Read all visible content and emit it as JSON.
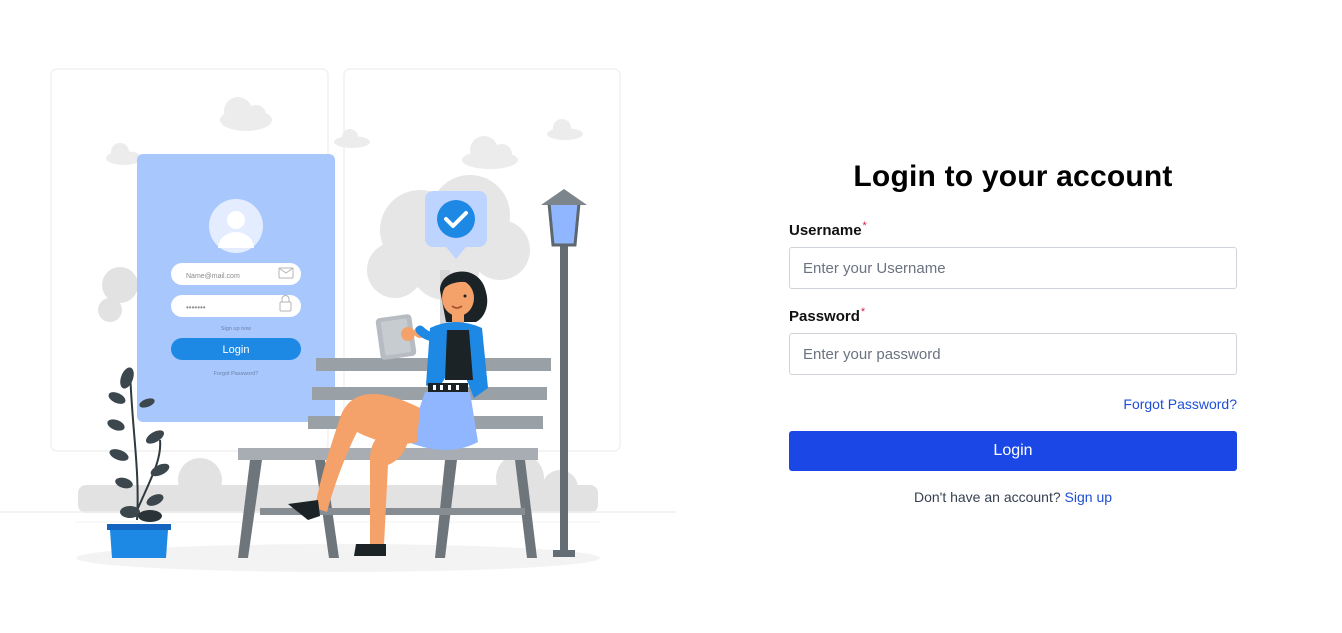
{
  "illustration": {
    "mini_form": {
      "email_placeholder": "Name@mail.com",
      "password_mask": "•••••••",
      "signup_text": "Sign up now",
      "login_label": "Login",
      "forgot_text": "Forgot Password?"
    }
  },
  "login": {
    "title": "Login to your account",
    "username_label": "Username",
    "username_placeholder": "Enter your Username",
    "password_label": "Password",
    "password_placeholder": "Enter your password",
    "required_marker": "*",
    "forgot_password": "Forgot Password?",
    "submit_label": "Login",
    "signup_prompt": "Don't have an account?",
    "signup_link": "Sign up"
  },
  "colors": {
    "primary": "#1a47e6",
    "link": "#1d4ed8",
    "illustration_blue": "#1e88e5",
    "card_blue": "#a8c8fd"
  }
}
